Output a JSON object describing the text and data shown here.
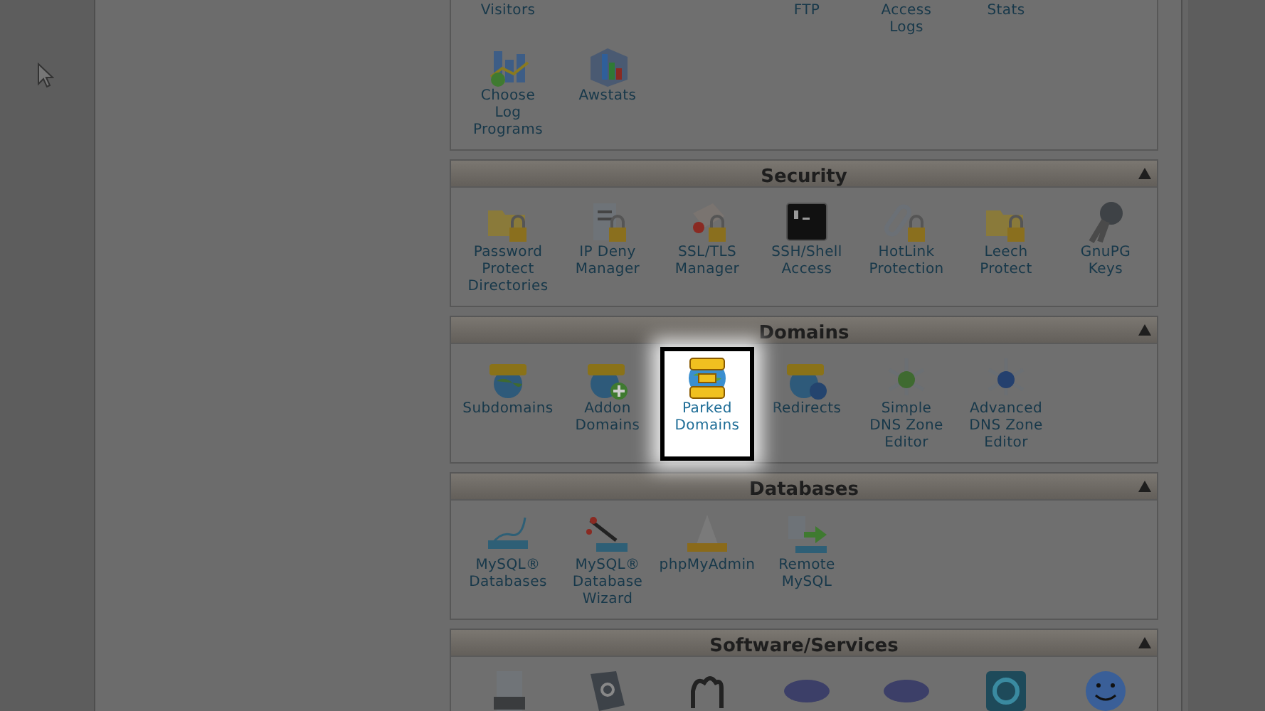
{
  "logs_panel": {
    "items": [
      {
        "kind": "label_only",
        "label": "Visitors"
      },
      {
        "kind": "blank"
      },
      {
        "kind": "blank"
      },
      {
        "kind": "label_only",
        "label": "FTP"
      },
      {
        "kind": "label_only",
        "label": "Access\nLogs"
      },
      {
        "kind": "label_only",
        "label": "Stats"
      },
      {
        "kind": "blank"
      },
      {
        "kind": "icon",
        "label": "Choose\nLog\nPrograms",
        "selected": false
      },
      {
        "kind": "icon",
        "label": "Awstats",
        "selected": false
      }
    ]
  },
  "sections": [
    {
      "title": "Security",
      "items": [
        {
          "kind": "icon",
          "label": "Password\nProtect\nDirectories",
          "selected": false
        },
        {
          "kind": "icon",
          "label": "IP Deny\nManager",
          "selected": false
        },
        {
          "kind": "icon",
          "label": "SSL/TLS\nManager",
          "selected": false
        },
        {
          "kind": "icon",
          "label": "SSH/Shell\nAccess",
          "selected": false
        },
        {
          "kind": "icon",
          "label": "HotLink\nProtection",
          "selected": false
        },
        {
          "kind": "icon",
          "label": "Leech\nProtect",
          "selected": false
        },
        {
          "kind": "icon",
          "label": "GnuPG\nKeys",
          "selected": false
        }
      ]
    },
    {
      "title": "Domains",
      "items": [
        {
          "kind": "icon",
          "label": "Subdomains",
          "selected": false
        },
        {
          "kind": "icon",
          "label": "Addon\nDomains",
          "selected": false
        },
        {
          "kind": "icon",
          "label": "Parked\nDomains",
          "selected": true
        },
        {
          "kind": "icon",
          "label": "Redirects",
          "selected": false
        },
        {
          "kind": "icon",
          "label": "Simple\nDNS Zone\nEditor",
          "selected": false
        },
        {
          "kind": "icon",
          "label": "Advanced\nDNS Zone\nEditor",
          "selected": false
        }
      ]
    },
    {
      "title": "Databases",
      "items": [
        {
          "kind": "icon",
          "label": "MySQL®\nDatabases",
          "selected": false
        },
        {
          "kind": "icon",
          "label": "MySQL®\nDatabase\nWizard",
          "selected": false
        },
        {
          "kind": "icon",
          "label": "phpMyAdmin",
          "selected": false
        },
        {
          "kind": "icon",
          "label": "Remote\nMySQL",
          "selected": false
        }
      ]
    },
    {
      "title": "Software/Services",
      "items": [
        {
          "kind": "icon_only",
          "selected": false
        },
        {
          "kind": "icon_only",
          "selected": false
        },
        {
          "kind": "icon_only",
          "selected": false
        },
        {
          "kind": "icon_only",
          "selected": false
        },
        {
          "kind": "icon_only",
          "selected": false
        },
        {
          "kind": "icon_only",
          "selected": false
        },
        {
          "kind": "icon_only",
          "selected": false
        }
      ]
    }
  ]
}
